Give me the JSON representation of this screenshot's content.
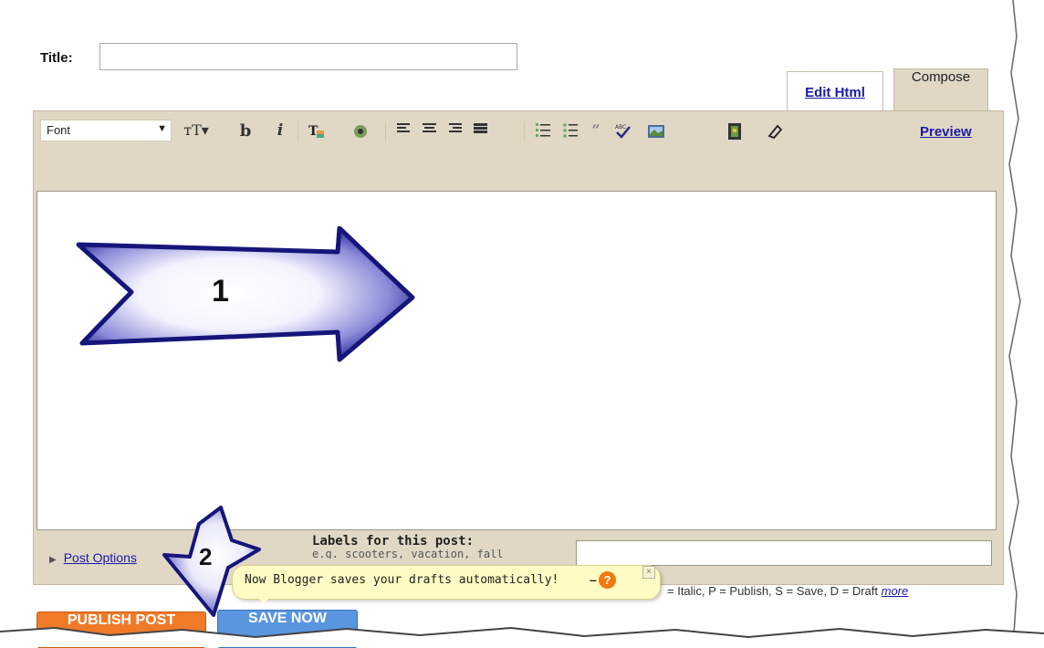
{
  "title_row": {
    "label": "Title:",
    "value": ""
  },
  "tabs": [
    {
      "label": "Edit Html",
      "active": false
    },
    {
      "label": "Compose",
      "active": true
    }
  ],
  "toolbar": {
    "font_select": "Font",
    "bold_glyph": "b",
    "italic_glyph": "i",
    "preview_link": "Preview",
    "icons": [
      "font-size-icon",
      "bold-icon",
      "italic-icon",
      "text-color-icon",
      "link-icon",
      "align-left-icon",
      "align-center-icon",
      "align-right-icon",
      "align-justify-icon",
      "numbered-list-icon",
      "bullet-list-icon",
      "blockquote-icon",
      "spellcheck-icon",
      "image-icon",
      "video-icon",
      "clear-formatting-icon"
    ]
  },
  "post_options": {
    "label": "Post Options"
  },
  "labels": {
    "label": "Labels for this post:",
    "example": "e.g. scooters, vacation, fall",
    "value": ""
  },
  "shortcuts": {
    "text": "= Italic, P = Publish, S = Save, D = Draft",
    "more_link": "more"
  },
  "notification": {
    "text": "Now Blogger saves your drafts automatically!",
    "dash": "–",
    "help_glyph": "?",
    "close_glyph": "×"
  },
  "buttons": {
    "publish": "PUBLISH POST",
    "save": "SAVE NOW"
  },
  "annotations": {
    "arrow1": "1",
    "arrow2": "2"
  },
  "colors": {
    "tab_bg": "#e0d8c5",
    "link": "#1a1aa6",
    "publish": "#f07a28",
    "save": "#5a96e0",
    "notify_bg": "#fffbc4",
    "arrow_blue": "#1e1e8a"
  }
}
